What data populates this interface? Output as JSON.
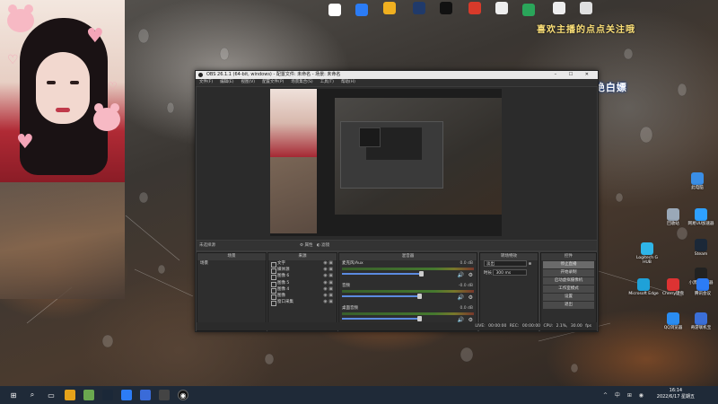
{
  "desktop": {
    "top_banner": "喜欢主播的点点关注哦",
    "slogan": "直播不易 拒绝白嫖",
    "icons_right": [
      {
        "label": "此电脑",
        "color": "#3a8ee6"
      },
      {
        "label": "回收站",
        "color": "#9aa8b8"
      },
      {
        "label": "网易UU加速器",
        "color": "#2ea0ff"
      },
      {
        "label": "Steam",
        "color": "#1b2838"
      },
      {
        "label": "Logitech G HUB",
        "color": "#2fb5e8"
      },
      {
        "label": "小黑盒加速器",
        "color": "#222"
      },
      {
        "label": "Microsoft Edge",
        "color": "#1fa1d8"
      },
      {
        "label": "Cherry键盘",
        "color": "#d33"
      },
      {
        "label": "腾讯会议",
        "color": "#2c7cf6"
      },
      {
        "label": "QQ浏览器",
        "color": "#2a8cf0"
      },
      {
        "label": "奇游联机宝",
        "color": "#3b6fd8"
      }
    ],
    "icons_top": [
      {
        "label": "",
        "color": "#ffffff"
      },
      {
        "label": "",
        "color": "#2b7cf6"
      },
      {
        "label": "",
        "color": "#f0b020"
      },
      {
        "label": "",
        "color": "#203a6a"
      },
      {
        "label": "",
        "color": "#111"
      },
      {
        "label": "",
        "color": "#d83a2a"
      },
      {
        "label": "",
        "color": "#eeeeee"
      },
      {
        "label": "",
        "color": "#2aa55a"
      },
      {
        "label": "",
        "color": "#eeeeee"
      },
      {
        "label": "",
        "color": "#e0e0e0"
      }
    ]
  },
  "obs": {
    "title": "OBS 26.1.1 (64-bit, windows) - 配置文件: 未命名 - 场景: 未命名",
    "menu": [
      "文件(F)",
      "编辑(E)",
      "视图(V)",
      "配置文件(P)",
      "场景集合(S)",
      "工具(T)",
      "帮助(H)"
    ],
    "no_source": "未选择源",
    "properties_btn": "属性",
    "filters_btn": "滤镜",
    "docks": {
      "scenes": {
        "title": "场景",
        "items": [
          "场景"
        ]
      },
      "sources": {
        "title": "来源",
        "items": [
          "文字",
          "媒体源",
          "图像 6",
          "图像 5",
          "图像 4",
          "图像",
          "窗口采集"
        ]
      },
      "mixer": {
        "title": "混音器",
        "channels": [
          {
            "name": "麦克风/Aux",
            "db": "0.0 dB",
            "level": 0.92
          },
          {
            "name": "音频",
            "db": "-0.0 dB",
            "level": 0.9
          },
          {
            "name": "桌面音频",
            "db": "0.0 dB",
            "level": 0.9
          }
        ]
      },
      "transitions": {
        "title": "转场特效",
        "select": "淡出",
        "duration_label": "时长",
        "duration": "300 ms"
      },
      "controls": {
        "title": "控件",
        "buttons": [
          "停止直播",
          "开始录制",
          "启动虚拟摄像机",
          "工作室模式",
          "设置",
          "退出"
        ]
      }
    },
    "status": {
      "live": "LIVE: 00:00:00",
      "rec": "REC: 00:00:00",
      "cpu": "CPU: 2.1%, 30.00 fps"
    }
  },
  "taskbar": {
    "time": "16:14",
    "date": "2022/6/17 星期五",
    "tray": "^ 中 ⊞ ◉"
  }
}
